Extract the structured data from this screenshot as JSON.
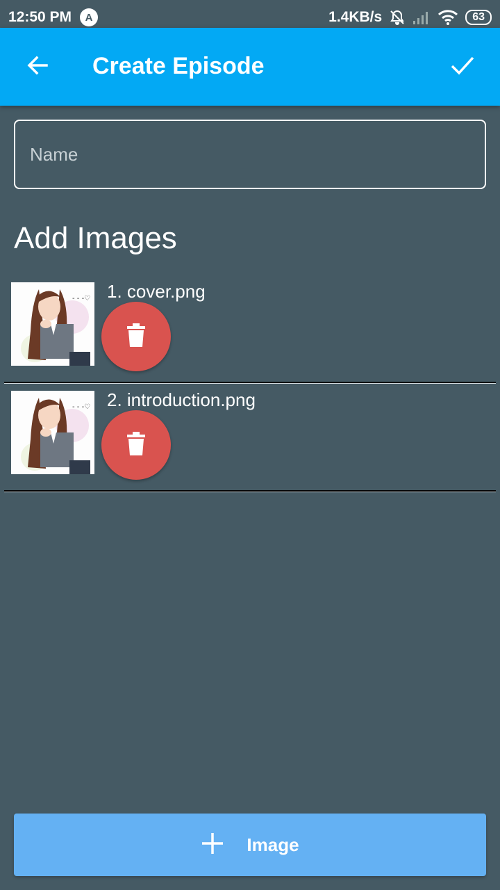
{
  "status_bar": {
    "time": "12:50 PM",
    "app_icon_letter": "A",
    "net_speed": "1.4KB/s",
    "battery": "63"
  },
  "app_bar": {
    "title": "Create Episode",
    "back_icon": "arrow-left-icon",
    "confirm_icon": "check-icon"
  },
  "form": {
    "name_placeholder": "Name",
    "name_value": ""
  },
  "images_section": {
    "title": "Add Images",
    "items": [
      {
        "label": "1. cover.png"
      },
      {
        "label": "2. introduction.png"
      }
    ]
  },
  "bottom_button": {
    "label": "Image",
    "icon": "plus-icon"
  },
  "colors": {
    "background": "#455a64",
    "app_bar": "#03a9f4",
    "delete": "#d9534f",
    "add_button": "#64b1f3"
  }
}
